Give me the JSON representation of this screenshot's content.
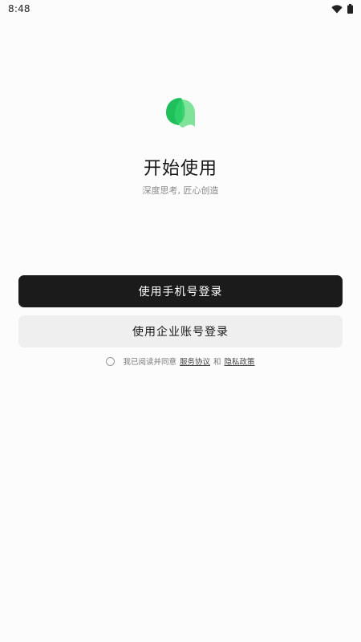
{
  "status_bar": {
    "time": "8:48",
    "icons": [
      "wifi-icon",
      "battery-icon"
    ]
  },
  "brand": {
    "logo_icon": "app-logo-icon",
    "logo_colors": {
      "dark": "#1fbf5b",
      "light": "#6fe08e"
    }
  },
  "header": {
    "title": "开始使用",
    "subtitle": "深度思考, 匠心创造"
  },
  "actions": {
    "phone_login_label": "使用手机号登录",
    "enterprise_login_label": "使用企业账号登录"
  },
  "agreement": {
    "checked": false,
    "prefix": "我已阅读并同意",
    "terms_label": "服务协议",
    "conjunction": "和",
    "privacy_label": "隐私政策"
  },
  "colors": {
    "background": "#fcfcfc",
    "primary_button": "#1b1b1b",
    "secondary_button": "#efefef"
  }
}
